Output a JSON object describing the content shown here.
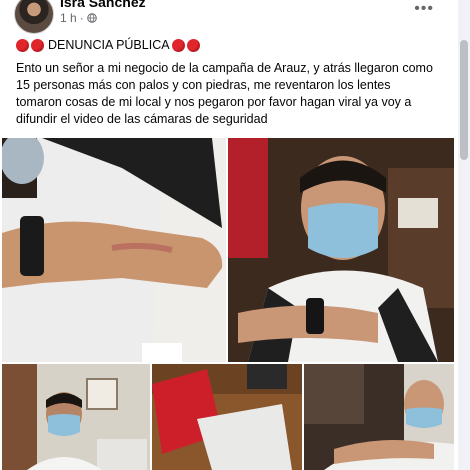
{
  "post": {
    "author": "Isra Sánchez",
    "time": "1 h",
    "visibility_icon": "globe-icon",
    "more_icon": "more-options-icon",
    "title": "DENUNCIA PÚBLICA",
    "body": "Ento un señor a mi negocio de la campaña de Arauz, y atrás llegaron como 15 personas más con palos y con piedras, me reventaron los lentes tomaron cosas de mi local y nos pegaron por favor hagan viral ya voy a difundir el video de las cámaras de seguridad"
  },
  "colors": {
    "text": "#050505",
    "meta": "#65676b",
    "emoji_red": "#e0252b"
  }
}
